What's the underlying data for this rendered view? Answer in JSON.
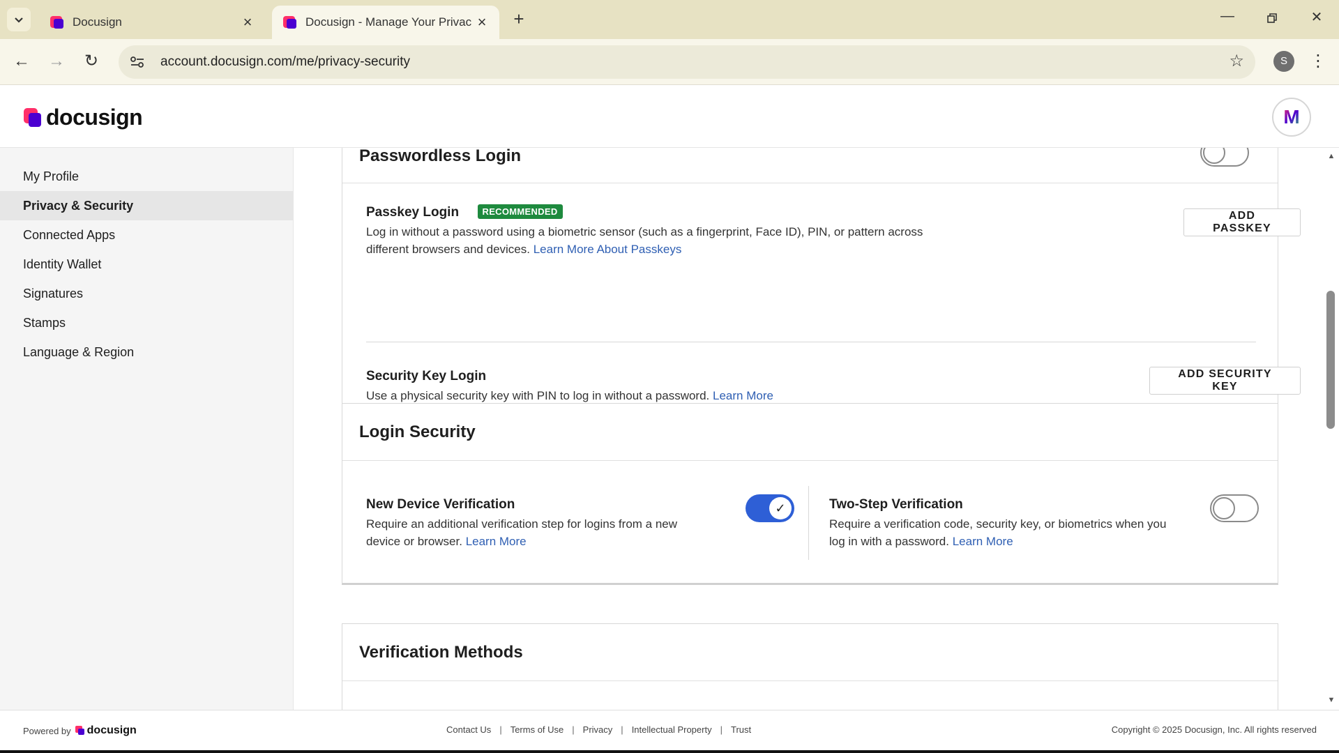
{
  "browser": {
    "tabs": [
      {
        "title": "Docusign",
        "active": false
      },
      {
        "title": "Docusign - Manage Your Privac",
        "active": true
      }
    ],
    "url": "account.docusign.com/me/privacy-security",
    "profile_initial": "S"
  },
  "header": {
    "logo_text": "docusign",
    "avatar_initial": "M"
  },
  "sidebar": {
    "items": [
      {
        "label": "My Profile",
        "active": false
      },
      {
        "label": "Privacy & Security",
        "active": true
      },
      {
        "label": "Connected Apps",
        "active": false
      },
      {
        "label": "Identity Wallet",
        "active": false
      },
      {
        "label": "Signatures",
        "active": false
      },
      {
        "label": "Stamps",
        "active": false
      },
      {
        "label": "Language & Region",
        "active": false
      }
    ]
  },
  "passwordless": {
    "title": "Passwordless Login",
    "toggle_on": false,
    "passkey": {
      "title": "Passkey Login",
      "badge": "RECOMMENDED",
      "desc_line1": "Log in without a password using a biometric sensor (such as a fingerprint, Face ID), PIN, or pattern across",
      "desc_line2": "different browsers and devices.",
      "link": "Learn More About Passkeys",
      "button": "ADD PASSKEY"
    },
    "security_key": {
      "title": "Security Key Login",
      "desc": "Use a physical security key with PIN to log in without a password.",
      "link": "Learn More",
      "button": "ADD SECURITY KEY"
    }
  },
  "login_security": {
    "title": "Login Security",
    "new_device": {
      "title": "New Device Verification",
      "desc_line1": "Require an additional verification step for logins from a new",
      "desc_line2": "device or browser.",
      "link": "Learn More",
      "toggle_on": true
    },
    "two_step": {
      "title": "Two-Step Verification",
      "desc_line1": "Require a verification code, security key, or biometrics when you",
      "desc_line2": "log in with a password.",
      "link": "Learn More",
      "toggle_on": false
    }
  },
  "verification_methods": {
    "title": "Verification Methods"
  },
  "footer": {
    "powered_by": "Powered by",
    "powered_logo": "docusign",
    "links": [
      "Contact Us",
      "Terms of Use",
      "Privacy",
      "Intellectual Property",
      "Trust"
    ],
    "copyright": "Copyright © 2025 Docusign, Inc. All rights reserved"
  },
  "colors": {
    "brand_pink": "#ff2f69",
    "brand_purple": "#4b00d1",
    "toggle_on": "#2e5fd6",
    "badge_green": "#1e8a3e",
    "link_blue": "#2f5fb3"
  }
}
